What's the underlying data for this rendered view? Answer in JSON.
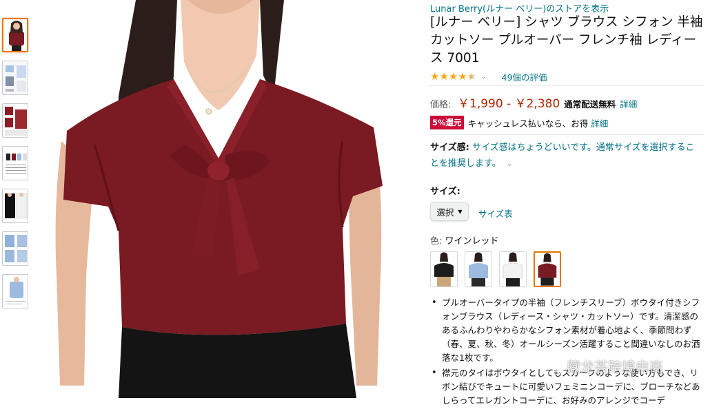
{
  "thumbnails": [
    {
      "label": "thumbnail-1",
      "selected": true
    },
    {
      "label": "thumbnail-2",
      "selected": false
    },
    {
      "label": "thumbnail-3",
      "selected": false
    },
    {
      "label": "thumbnail-4",
      "selected": false
    },
    {
      "label": "thumbnail-5",
      "selected": false
    },
    {
      "label": "thumbnail-6",
      "selected": false
    },
    {
      "label": "thumbnail-7",
      "selected": false
    }
  ],
  "product": {
    "store_link": "Lunar Berry(ルナー ベリー)のストアを表示",
    "title": "[ルナー ベリー] シャツ ブラウス シフォン 半袖 カットソー プルオーバー フレンチ袖 レディース 7001",
    "rating": 4.0,
    "reviews": "49個の評価",
    "price_label": "価格:",
    "price": "￥1,990 - ￥2,380",
    "shipping": "通常配送無料",
    "detail_link": "詳細",
    "cashless_badge": "5%還元",
    "cashless_text": "キャッシュレス払いなら、お得",
    "cashless_detail": "詳細",
    "size_feel_label": "サイズ感:",
    "size_feel_text": "サイズ感はちょうどいいです。通常サイズを選択することを推奨します。",
    "size_label": "サイズ:",
    "size_select": "選択",
    "size_chart": "サイズ表",
    "color_label": "色:",
    "color_value": "ワインレッド",
    "bullets": [
      "プルオーバータイプの半袖（フレンチスリーブ）ボウタイ付きシフォンブラウス（レディース・シャツ・カットソー）です。清潔感のあるふんわりやわらかなシフォン素材が着心地よく、季節問わず（春、夏、秋、冬）オールシーズン活躍すること間違いなしのお洒落な1枚です。",
      "襟元のタイはボウタイとしてもスカーフのような使い方もでき、リボン結びでキュートに可愛いフェミニンコーデに、ブローチなどあしらってエレガントコーデに、お好みのアレンジでコーデ"
    ]
  },
  "colors": {
    "wine": "#7a1a22",
    "link": "#007185",
    "price": "#b12704",
    "star": "#f7a71c",
    "badge": "#cc0c39",
    "selected_border": "#e77600"
  },
  "swatches": [
    {
      "name": "ブラック",
      "color": "#1c1c1c"
    },
    {
      "name": "ブルー",
      "color": "#9dbadf"
    },
    {
      "name": "ホワイト",
      "color": "#f2f2f2"
    },
    {
      "name": "ワインレッド",
      "color": "#7a1a22",
      "selected": true
    }
  ],
  "watermark": "藏龙荟跨境电商"
}
